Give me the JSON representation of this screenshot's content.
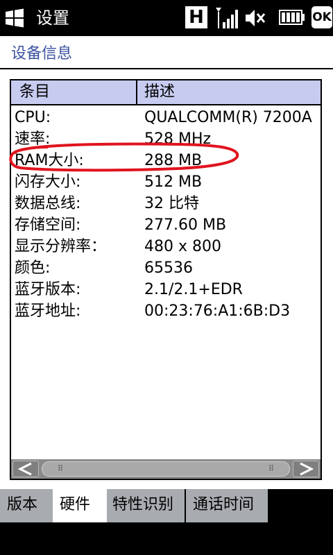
{
  "status_bar": {
    "app_title": "设置",
    "network_badge": "H",
    "ok_label": "OK"
  },
  "page": {
    "title": "设备信息"
  },
  "table": {
    "columns": [
      "条目",
      "描述"
    ],
    "rows": [
      {
        "item": "CPU:",
        "value": "QUALCOMM(R) 7200A"
      },
      {
        "item": "速率:",
        "value": "528 MHz"
      },
      {
        "item": "RAM大小:",
        "value": "288 MB"
      },
      {
        "item": "闪存大小:",
        "value": "512 MB"
      },
      {
        "item": "数据总线:",
        "value": "32 比特"
      },
      {
        "item": "存储空间:",
        "value": "277.60 MB"
      },
      {
        "item": "显示分辨率：",
        "value": "480 x 800"
      },
      {
        "item": "颜色:",
        "value": "65536"
      },
      {
        "item": "蓝牙版本:",
        "value": "2.1/2.1+EDR"
      },
      {
        "item": "蓝牙地址:",
        "value": "00:23:76:A1:6B:D3"
      }
    ],
    "highlighted_row": 2
  },
  "tabs": [
    {
      "label": "版本",
      "active": false
    },
    {
      "label": "硬件",
      "active": true
    },
    {
      "label": "特性识别",
      "active": false
    },
    {
      "label": "通话时间",
      "active": false
    }
  ],
  "colors": {
    "header_bg": "#c8cbf0",
    "title_blue": "#3b52a0",
    "annotation_red": "#e0141e"
  }
}
